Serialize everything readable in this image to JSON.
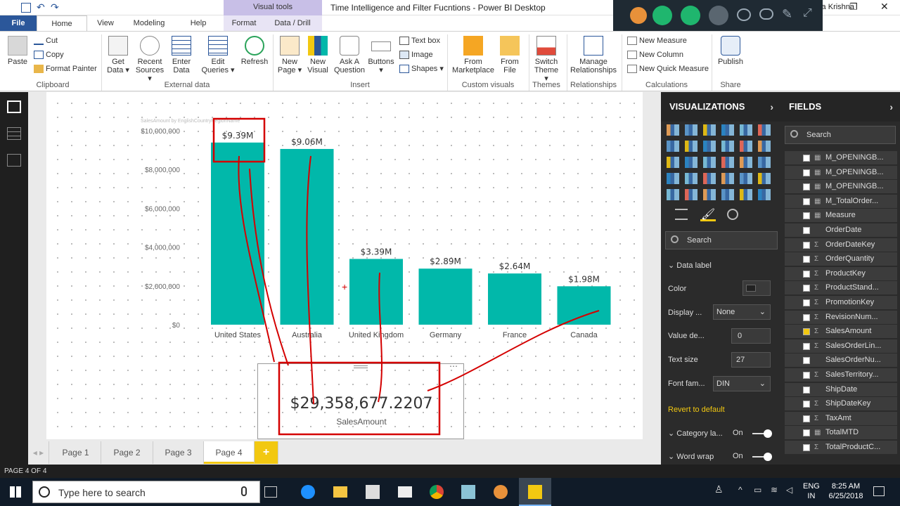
{
  "window": {
    "title": "Time Intelligence and Filter Fucntions - Power BI Desktop",
    "context_tab": "Visual tools",
    "user": "ala Krishna"
  },
  "tabs": [
    "File",
    "Home",
    "View",
    "Modeling",
    "Help",
    "Format",
    "Data / Drill"
  ],
  "ribbon": {
    "clipboard": {
      "paste": "Paste",
      "cut": "Cut",
      "copy": "Copy",
      "format_painter": "Format Painter",
      "group": "Clipboard"
    },
    "external": {
      "get_data": [
        "Get",
        "Data ▾"
      ],
      "recent": [
        "Recent",
        "Sources ▾"
      ],
      "enter": [
        "Enter",
        "Data"
      ],
      "edit": [
        "Edit",
        "Queries ▾"
      ],
      "refresh": "Refresh",
      "group": "External data"
    },
    "insert": {
      "new_page": [
        "New",
        "Page ▾"
      ],
      "new_visual": [
        "New",
        "Visual"
      ],
      "ask": [
        "Ask A",
        "Question"
      ],
      "buttons": [
        "Buttons",
        "▾"
      ],
      "text_box": "Text box",
      "image": "Image",
      "shapes": "Shapes ▾",
      "group": "Insert"
    },
    "custom": {
      "marketplace": [
        "From",
        "Marketplace"
      ],
      "file": [
        "From",
        "File"
      ],
      "group": "Custom visuals"
    },
    "themes": {
      "switch": [
        "Switch",
        "Theme ▾"
      ],
      "group": "Themes"
    },
    "relationships": {
      "manage": [
        "Manage",
        "Relationships"
      ],
      "group": "Relationships"
    },
    "calculations": {
      "new_measure": "New Measure",
      "new_column": "New Column",
      "new_quick": "New Quick Measure",
      "group": "Calculations"
    },
    "share": {
      "publish": "Publish",
      "group": "Share"
    }
  },
  "chart_data": {
    "type": "bar",
    "title": "SalesAmount by EnglishCountryRegionName",
    "categories": [
      "United States",
      "Australia",
      "United Kingdom",
      "Germany",
      "France",
      "Canada"
    ],
    "values": [
      9390000,
      9060000,
      3390000,
      2890000,
      2640000,
      1980000
    ],
    "data_labels": [
      "$9.39M",
      "$9.06M",
      "$3.39M",
      "$2.89M",
      "$2.64M",
      "$1.98M"
    ],
    "y_ticks": [
      "$10,000,000",
      "$8,000,000",
      "$6,000,000",
      "$4,000,000",
      "$2,000,000",
      "$0"
    ],
    "ylim": [
      0,
      10000000
    ],
    "color": "#01b8aa"
  },
  "card": {
    "value": "$29,358,677.2207",
    "label": "SalesAmount"
  },
  "page_tabs": [
    "Page 1",
    "Page 2",
    "Page 3",
    "Page 4",
    "+"
  ],
  "status": "PAGE 4 OF 4",
  "viz_pane": {
    "title": "VISUALIZATIONS",
    "search": "Search",
    "section": "Data label",
    "color_label": "Color",
    "display_label": "Display ...",
    "display_value": "None",
    "value_dec_label": "Value de...",
    "value_dec": "0",
    "text_size_label": "Text size",
    "text_size": "27",
    "font_label": "Font fam...",
    "font_value": "DIN",
    "revert": "Revert to default",
    "category_label": "Category la...",
    "category_state": "On",
    "wordwrap_label": "Word wrap",
    "wordwrap_state": "On"
  },
  "fields_pane": {
    "title": "FIELDS",
    "search": "Search",
    "items": [
      {
        "name": "M_OPENINGB...",
        "checked": false,
        "icon": "calc"
      },
      {
        "name": "M_OPENINGB...",
        "checked": false,
        "icon": "calc"
      },
      {
        "name": "M_OPENINGB...",
        "checked": false,
        "icon": "calc"
      },
      {
        "name": "M_TotalOrder...",
        "checked": false,
        "icon": "calc"
      },
      {
        "name": "Measure",
        "checked": false,
        "icon": "calc"
      },
      {
        "name": "OrderDate",
        "checked": false,
        "icon": ""
      },
      {
        "name": "OrderDateKey",
        "checked": false,
        "icon": "Σ"
      },
      {
        "name": "OrderQuantity",
        "checked": false,
        "icon": "Σ"
      },
      {
        "name": "ProductKey",
        "checked": false,
        "icon": "Σ"
      },
      {
        "name": "ProductStand...",
        "checked": false,
        "icon": "Σ"
      },
      {
        "name": "PromotionKey",
        "checked": false,
        "icon": "Σ"
      },
      {
        "name": "RevisionNum...",
        "checked": false,
        "icon": "Σ"
      },
      {
        "name": "SalesAmount",
        "checked": true,
        "icon": "Σ"
      },
      {
        "name": "SalesOrderLin...",
        "checked": false,
        "icon": "Σ"
      },
      {
        "name": "SalesOrderNu...",
        "checked": false,
        "icon": ""
      },
      {
        "name": "SalesTerritory...",
        "checked": false,
        "icon": "Σ"
      },
      {
        "name": "ShipDate",
        "checked": false,
        "icon": ""
      },
      {
        "name": "ShipDateKey",
        "checked": false,
        "icon": "Σ"
      },
      {
        "name": "TaxAmt",
        "checked": false,
        "icon": "Σ"
      },
      {
        "name": "TotalMTD",
        "checked": false,
        "icon": "calc"
      },
      {
        "name": "TotalProductC...",
        "checked": false,
        "icon": "Σ"
      }
    ]
  },
  "taskbar": {
    "search": "Type here to search",
    "time": "8:25 AM",
    "date": "6/25/2018",
    "lang": [
      "ENG",
      "IN"
    ]
  },
  "colors": {
    "accent": "#2b579a",
    "bar": "#01b8aa",
    "annotation": "#d40000",
    "pane": "#2b2b2b"
  }
}
